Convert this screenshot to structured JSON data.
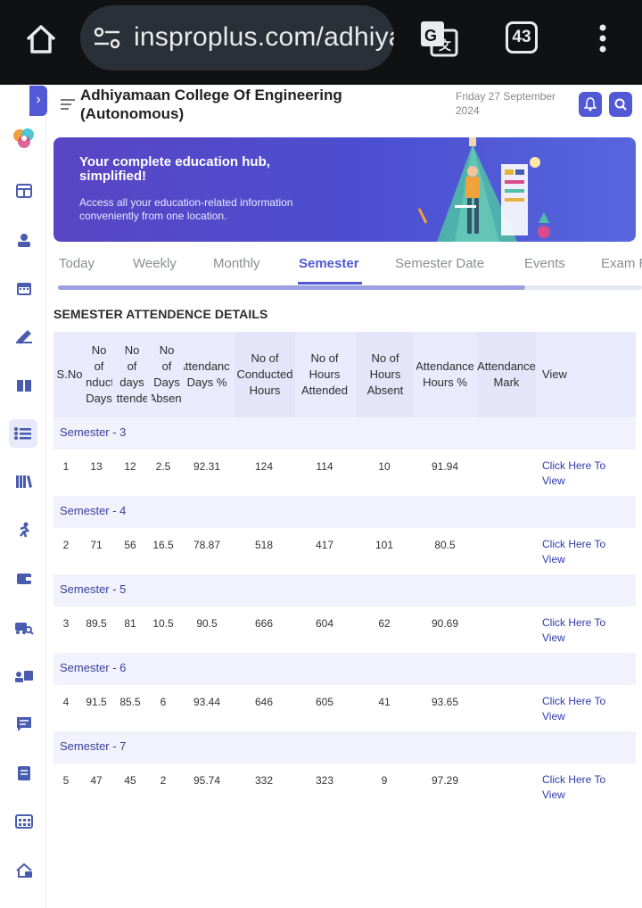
{
  "browser": {
    "url": "insproplus.com/adhiyamaan",
    "tab_count": "43"
  },
  "header": {
    "college_name": "Adhiyamaan College Of Engineering (Autonomous)",
    "date": "Friday 27 September 2024"
  },
  "banner": {
    "title": "Your complete education hub, simplified!",
    "subtitle": "Access all your education-related information conveniently from one location."
  },
  "tabs": [
    {
      "label": "Today",
      "active": false
    },
    {
      "label": "Weekly",
      "active": false
    },
    {
      "label": "Monthly",
      "active": false
    },
    {
      "label": "Semester",
      "active": true
    },
    {
      "label": "Semester Date",
      "active": false
    },
    {
      "label": "Events",
      "active": false
    },
    {
      "label": "Exam R",
      "active": false
    }
  ],
  "section_title": "SEMESTER ATTENDENCE DETAILS",
  "table": {
    "headers": [
      "S.No",
      "No\nof\nConducted\nDays",
      "No\nof\ndays\nAttended",
      "No\nof\nDays\nAbsent",
      "Attendance\nDays %",
      "No of\nConducted\nHours",
      "No of\nHours\nAttended",
      "No of\nHours\nAbsent",
      "Attendance\nHours %",
      "Attendance\nMark",
      "View"
    ],
    "rows": [
      {
        "semester": "Semester - 3",
        "sno": "1",
        "conducted_days": "13",
        "attended_days": "12",
        "absent_days": "2.5",
        "days_pct": "92.31",
        "conducted_hours": "124",
        "attended_hours": "114",
        "absent_hours": "10",
        "hours_pct": "91.94",
        "mark": "",
        "view": "Click Here To View"
      },
      {
        "semester": "Semester - 4",
        "sno": "2",
        "conducted_days": "71",
        "attended_days": "56",
        "absent_days": "16.5",
        "days_pct": "78.87",
        "conducted_hours": "518",
        "attended_hours": "417",
        "absent_hours": "101",
        "hours_pct": "80.5",
        "mark": "",
        "view": "Click Here To View"
      },
      {
        "semester": "Semester - 5",
        "sno": "3",
        "conducted_days": "89.5",
        "attended_days": "81",
        "absent_days": "10.5",
        "days_pct": "90.5",
        "conducted_hours": "666",
        "attended_hours": "604",
        "absent_hours": "62",
        "hours_pct": "90.69",
        "mark": "",
        "view": "Click Here To View"
      },
      {
        "semester": "Semester - 6",
        "sno": "4",
        "conducted_days": "91.5",
        "attended_days": "85.5",
        "absent_days": "6",
        "days_pct": "93.44",
        "conducted_hours": "646",
        "attended_hours": "605",
        "absent_hours": "41",
        "hours_pct": "93.65",
        "mark": "",
        "view": "Click Here To View"
      },
      {
        "semester": "Semester - 7",
        "sno": "5",
        "conducted_days": "47",
        "attended_days": "45",
        "absent_days": "2",
        "days_pct": "95.74",
        "conducted_hours": "332",
        "attended_hours": "323",
        "absent_hours": "9",
        "hours_pct": "97.29",
        "mark": "",
        "view": "Click Here To View"
      }
    ]
  },
  "colors": {
    "accent": "#5159d6",
    "header_bg": "#e9eafb",
    "semester_row_bg": "#f1f2fb",
    "link": "#2f3aa8"
  },
  "sidebar_icons": [
    "logo-icon",
    "dashboard-icon",
    "profile-icon",
    "calendar-icon",
    "assignment-icon",
    "book-icon",
    "attendance-icon",
    "library-icon",
    "sports-icon",
    "wallet-icon",
    "transport-search-icon",
    "hostel-icon",
    "feedback-icon",
    "notes-icon",
    "grid-icon",
    "home-icon"
  ]
}
